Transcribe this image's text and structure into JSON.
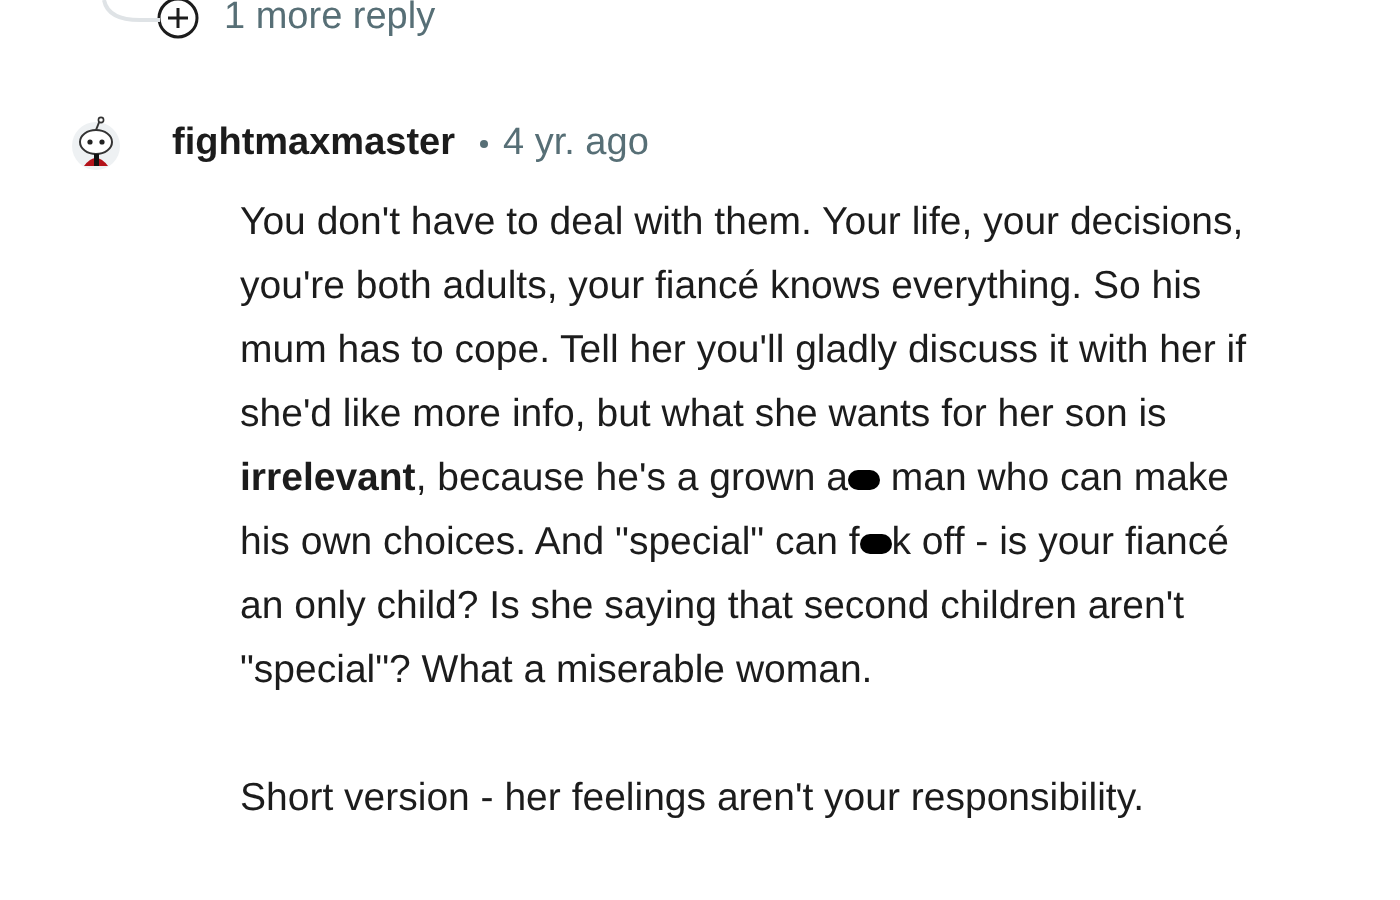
{
  "more_replies": {
    "label": "1 more reply"
  },
  "comment": {
    "author": "fightmaxmaster",
    "age": "4 yr. ago",
    "paragraphs": [
      {
        "segments": [
          {
            "kind": "text",
            "text": "You don't have to deal with them. Your life, your decisions, you're both adults, your fiancé knows everything. So his mum has to cope. Tell her you'll gladly discuss it with her if she'd like more info, but what she wants for her son is **irrelevant**, because he's a grown a"
          },
          {
            "kind": "censor"
          },
          {
            "kind": "text",
            "text": " man who can make his own choices. And \"special\" can f"
          },
          {
            "kind": "censor"
          },
          {
            "kind": "text",
            "text": "k off - is your fiancé an only child? Is she saying that second children aren't \"special\"? What a miserable woman."
          }
        ]
      },
      {
        "segments": [
          {
            "kind": "text",
            "text": "Short version - her feelings aren't your responsibility."
          }
        ]
      }
    ]
  }
}
